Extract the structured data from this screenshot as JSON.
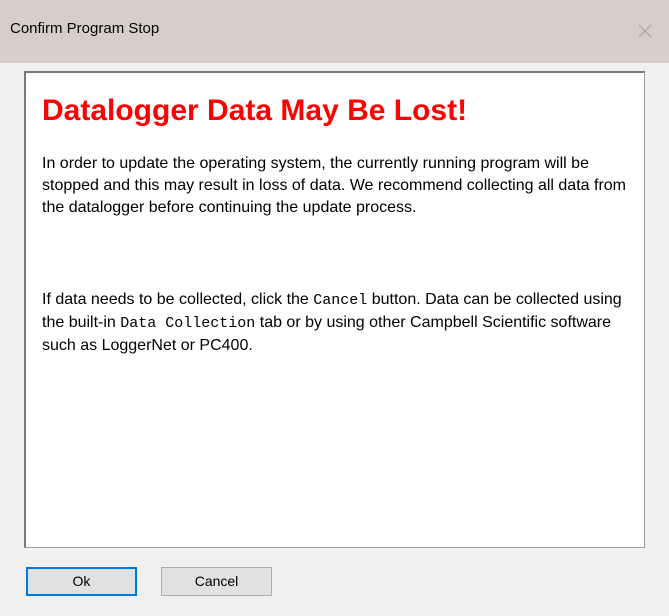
{
  "window": {
    "title": "Confirm Program Stop",
    "close_icon": "close-icon"
  },
  "message": {
    "heading": "Datalogger Data May Be Lost!",
    "paragraph1": "In order to update the operating system, the currently running program will be stopped and this may result in loss of data. We recommend collecting all data from the datalogger before continuing the update process.",
    "paragraph2": {
      "part1": "If data needs to be collected, click the ",
      "code1": "Cancel",
      "part2": " button. Data can be collected using the built-in ",
      "code2": "Data Collection",
      "part3": " tab or by using other Campbell Scientific software such as LoggerNet or PC400."
    }
  },
  "buttons": {
    "ok_label": "Ok",
    "cancel_label": "Cancel"
  },
  "colors": {
    "heading": "#ff0000",
    "titlebar": "#d6cfc7",
    "default_button_border": "#0078d7"
  }
}
